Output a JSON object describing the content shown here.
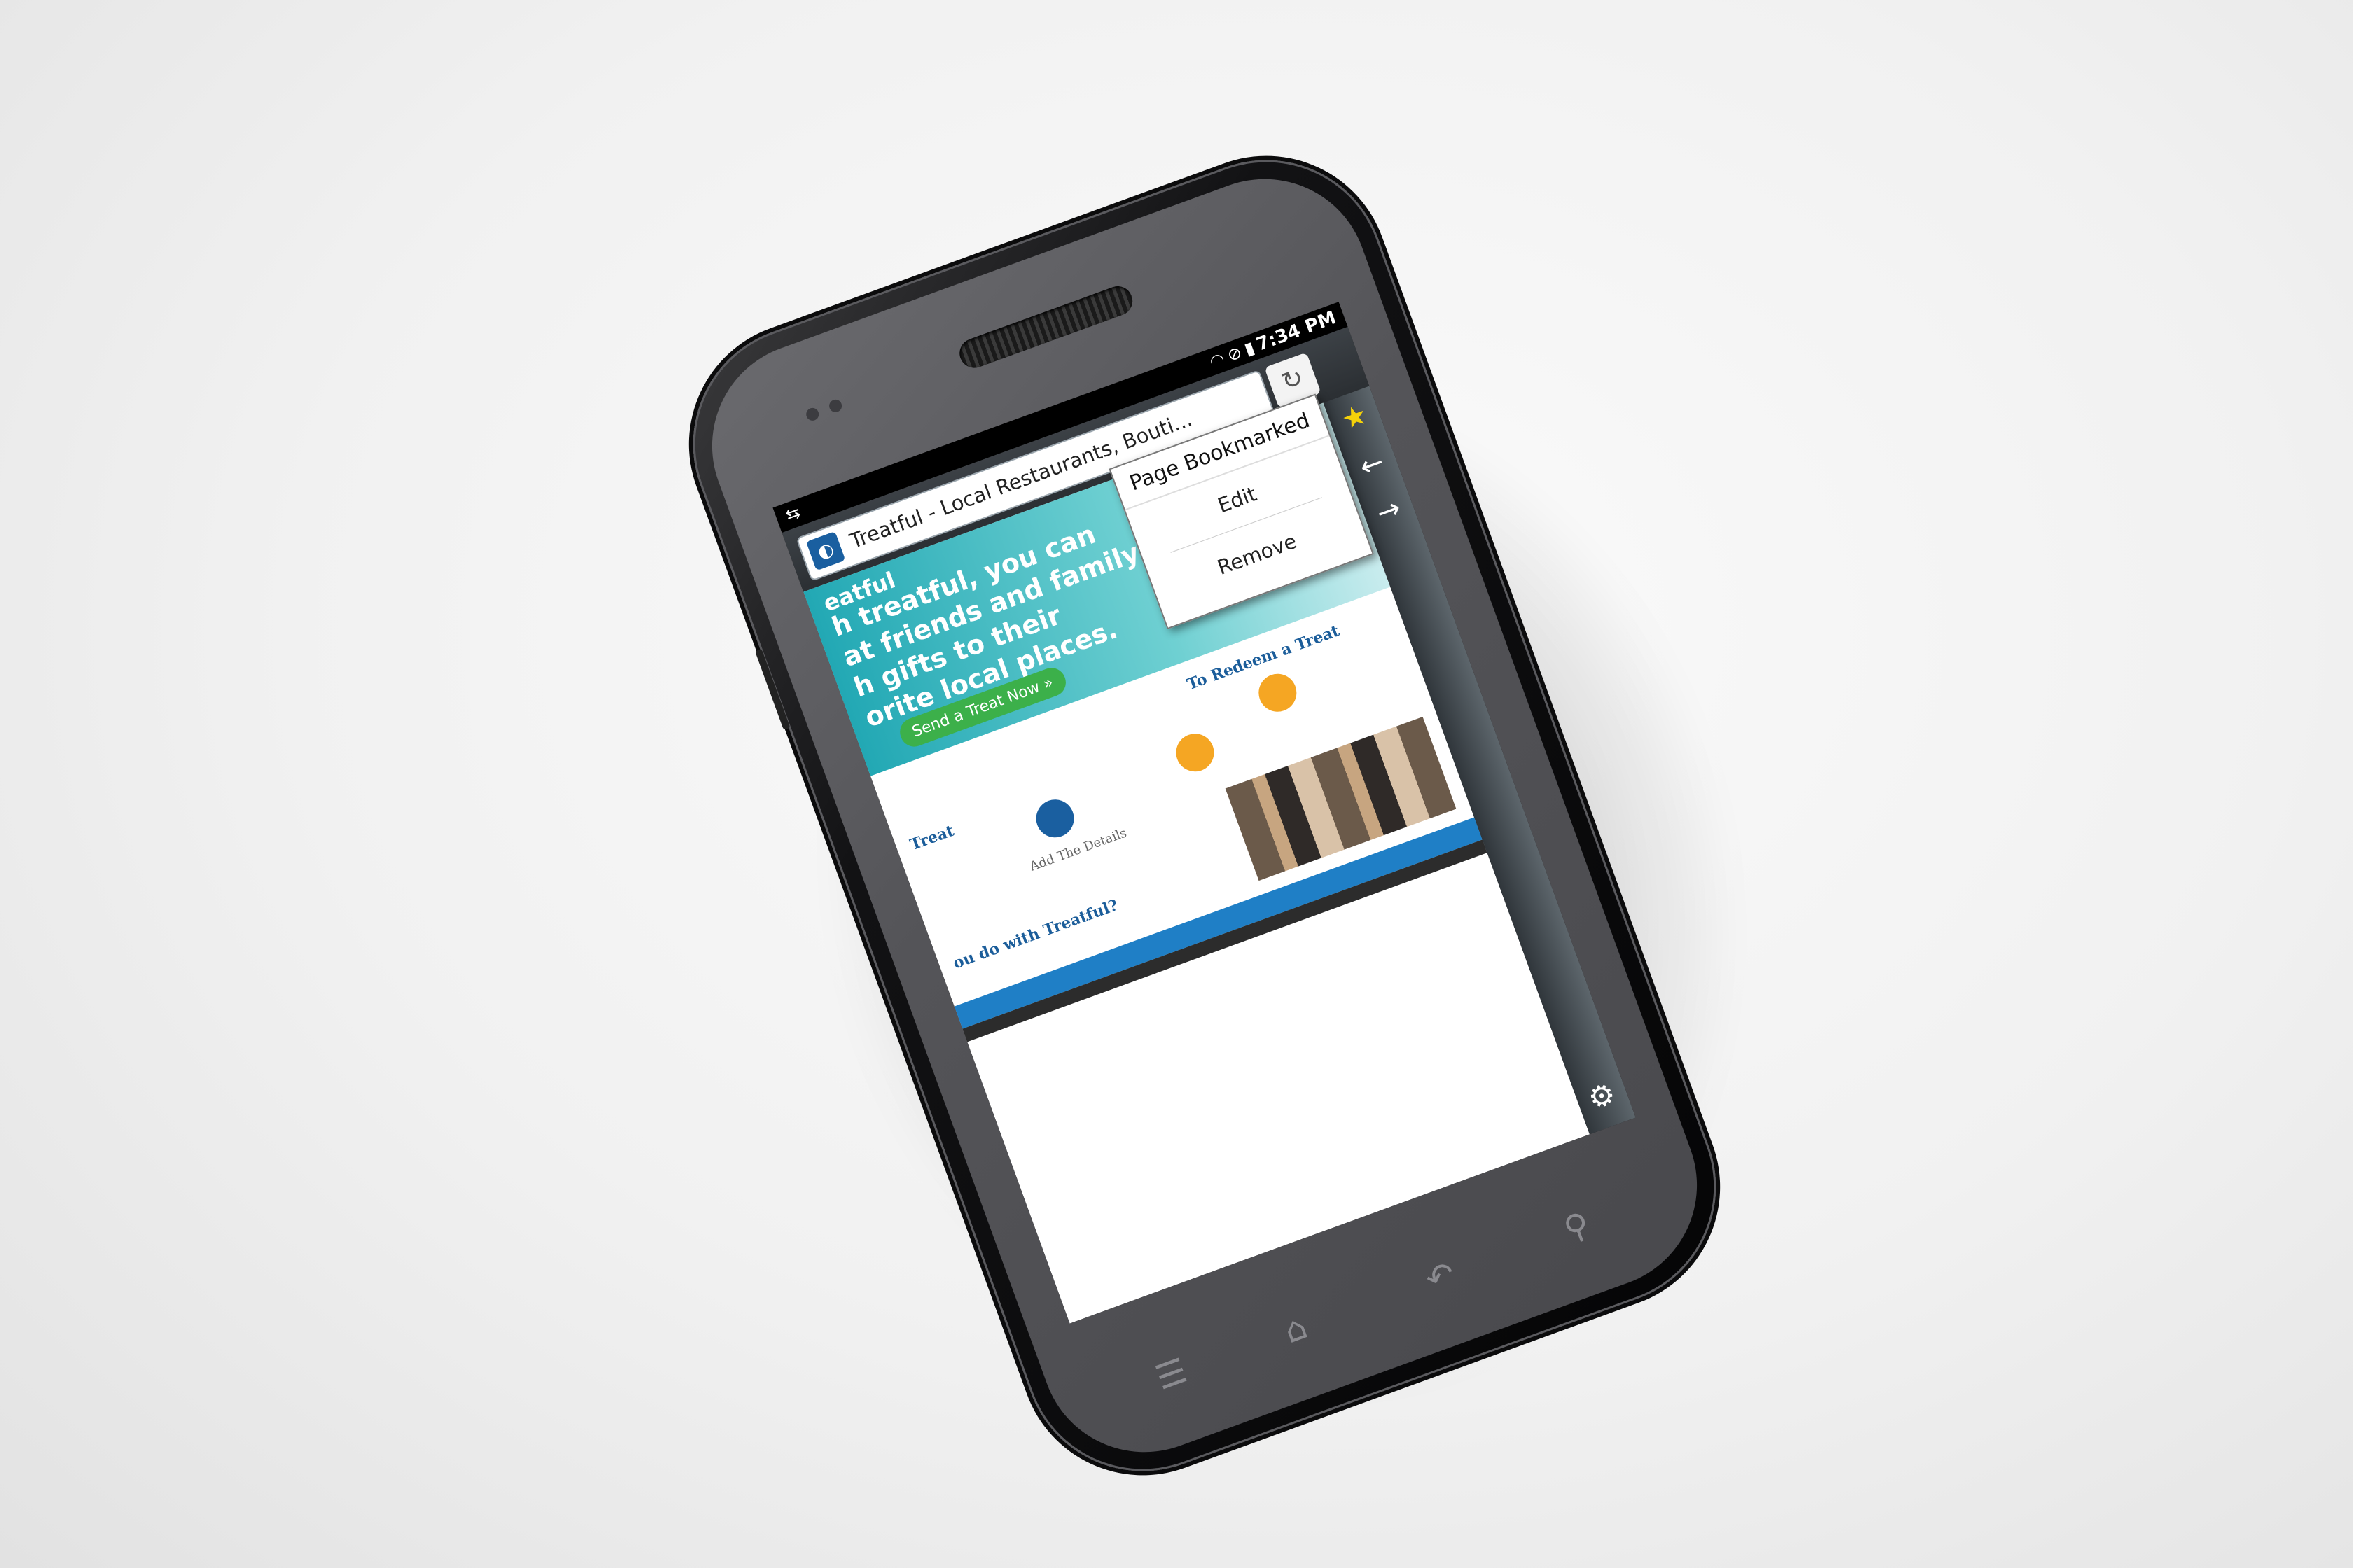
{
  "status_bar": {
    "time": "7:34 PM",
    "icons": [
      "usb-icon",
      "wifi-icon",
      "no-signal-icon",
      "battery-charging-icon"
    ]
  },
  "browser": {
    "page_title": "Treatful - Local Restaurants, Bouti...",
    "favicon": "treatful-favicon",
    "reload": "reload-icon"
  },
  "bookmark_popup": {
    "title": "Page Bookmarked",
    "items": [
      "Edit",
      "Remove"
    ]
  },
  "sidebar": {
    "buttons": [
      "star-icon",
      "back-arrow-icon",
      "forward-arrow-icon",
      "gear-icon"
    ]
  },
  "webpage": {
    "logo": "eatful",
    "headline_lines": [
      "h treatful, you can",
      "at friends and family",
      "h gifts to their",
      "orite local places."
    ],
    "cta": "Send a Treat Now »",
    "redeem_heading": "To Redeem a Treat",
    "treat_heading": "Treat",
    "details_label": "Add The Details",
    "what_heading": "ou do with Treatful?"
  },
  "hardware_keys": [
    "menu-key-icon",
    "home-key-icon",
    "back-key-icon",
    "search-key-icon"
  ],
  "colors": {
    "banner": "#22a8b4",
    "cta": "#3cb04a",
    "link_blue": "#1b5d9a",
    "star": "#f4d10a"
  }
}
